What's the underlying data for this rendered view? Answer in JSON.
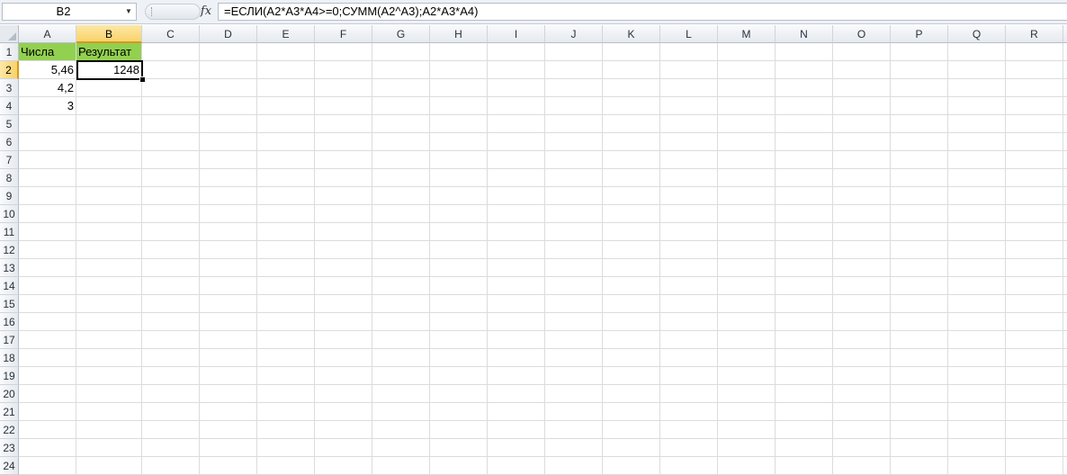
{
  "formula_bar": {
    "name_box": "B2",
    "fx_label": "fx",
    "formula": "=ЕСЛИ(A2*A3*A4>=0;СУММ(A2^A3);A2*A3*A4)"
  },
  "columns": [
    "A",
    "B",
    "C",
    "D",
    "E",
    "F",
    "G",
    "H",
    "I",
    "J",
    "K",
    "L",
    "M",
    "N",
    "O",
    "P",
    "Q",
    "R"
  ],
  "rows": [
    "1",
    "2",
    "3",
    "4",
    "5",
    "6",
    "7",
    "8",
    "9",
    "10",
    "11",
    "12",
    "13",
    "14",
    "15",
    "16",
    "17",
    "18",
    "19",
    "20",
    "21",
    "22",
    "23",
    "24"
  ],
  "active_cell": {
    "column": "B",
    "row": "2"
  },
  "cells": {
    "A1": "Числа",
    "B1": "Результат",
    "A2": "5,46",
    "B2": "1248",
    "A3": "4,2",
    "A4": "3"
  },
  "colors": {
    "header_fill": "#92d050",
    "active_header": "#f9d26a"
  }
}
